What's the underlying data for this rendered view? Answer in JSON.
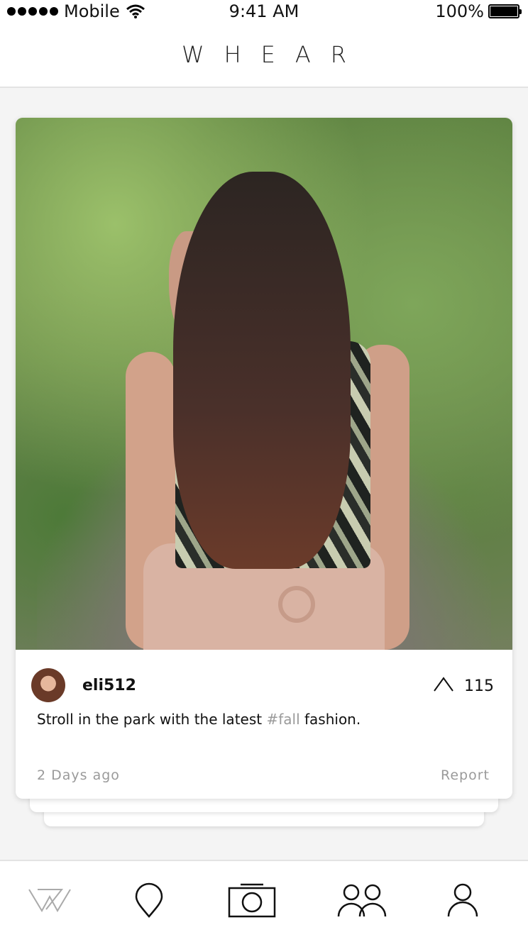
{
  "status_bar": {
    "carrier": "Mobile",
    "time": "9:41 AM",
    "battery": "100%"
  },
  "header": {
    "title": "WHEAR"
  },
  "post": {
    "username": "eli512",
    "upvotes": "115",
    "caption_before": "Stroll in the park with the latest ",
    "hashtag": "#fall",
    "caption_after": " fashion.",
    "time": "2 Days ago",
    "report_label": "Report"
  },
  "tabs": [
    {
      "icon": "whear-logo-icon",
      "active": true
    },
    {
      "icon": "location-pin-icon",
      "active": false
    },
    {
      "icon": "camera-icon",
      "active": false
    },
    {
      "icon": "friends-icon",
      "active": false
    },
    {
      "icon": "profile-icon",
      "active": false
    }
  ],
  "colors": {
    "muted_text": "#9a9a9a",
    "icon_stroke": "#111111",
    "inactive_logo": "#aaaaaa"
  }
}
